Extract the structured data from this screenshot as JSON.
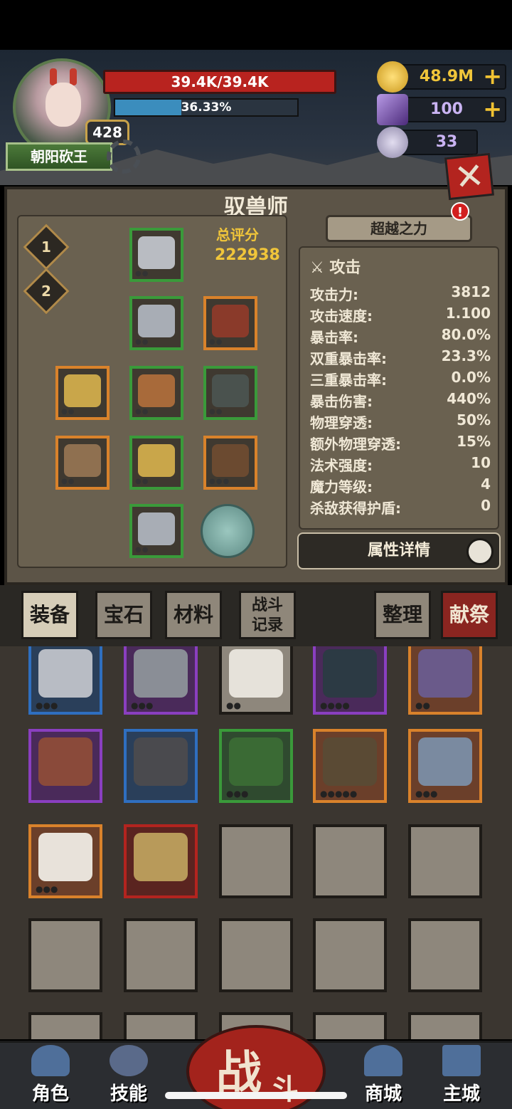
{
  "player": {
    "name": "朝阳砍王",
    "level": "428",
    "hp_text": "39.4K/39.4K",
    "xp_text": "36.33%",
    "xp_percent": 36.33
  },
  "resources": {
    "gold": "48.9M",
    "gems": "100",
    "skull": "33"
  },
  "panel": {
    "title": "驭兽师",
    "score_label": "总评分",
    "score_value": "222938",
    "loadouts": [
      "1",
      "2"
    ],
    "transcend_label": "超越之力",
    "alert_badge": "!",
    "detail_button": "属性详情"
  },
  "stats": {
    "header": "攻击",
    "rows": [
      {
        "label": "攻击力:",
        "value": "3812"
      },
      {
        "label": "攻击速度:",
        "value": "1.100"
      },
      {
        "label": "暴击率:",
        "value": "80.0%"
      },
      {
        "label": "双重暴击率:",
        "value": "23.3%"
      },
      {
        "label": "三重暴击率:",
        "value": "0.0%"
      },
      {
        "label": "暴击伤害:",
        "value": "440%"
      },
      {
        "label": "物理穿透:",
        "value": "50%"
      },
      {
        "label": "额外物理穿透:",
        "value": "15%"
      },
      {
        "label": "法术强度:",
        "value": "10"
      },
      {
        "label": "魔力等级:",
        "value": "4"
      },
      {
        "label": "杀敌获得护盾:",
        "value": "0"
      }
    ]
  },
  "tabs": {
    "equip": "装备",
    "gem": "宝石",
    "material": "材料",
    "battle_log_1": "战斗",
    "battle_log_2": "记录",
    "sort": "整理",
    "sacrifice": "献祭"
  },
  "nav": {
    "character": "角色",
    "skill": "技能",
    "battle_1": "战",
    "battle_2": "斗",
    "shop": "商城",
    "city": "主城"
  },
  "icons": {
    "gold": "gold-coin-icon",
    "gem": "purple-crystal-icon",
    "skull": "ram-skull-icon",
    "close": "close-icon",
    "search": "magnifier-icon"
  },
  "colors": {
    "hp": "#b8231f",
    "xp": "#3b8dbd",
    "accent_gold": "#f0c53a",
    "rarity_orange": "#d9822b",
    "rarity_green": "#3a9a3a",
    "rarity_purple": "#8a3fc0",
    "rarity_blue": "#2f6fc0"
  }
}
